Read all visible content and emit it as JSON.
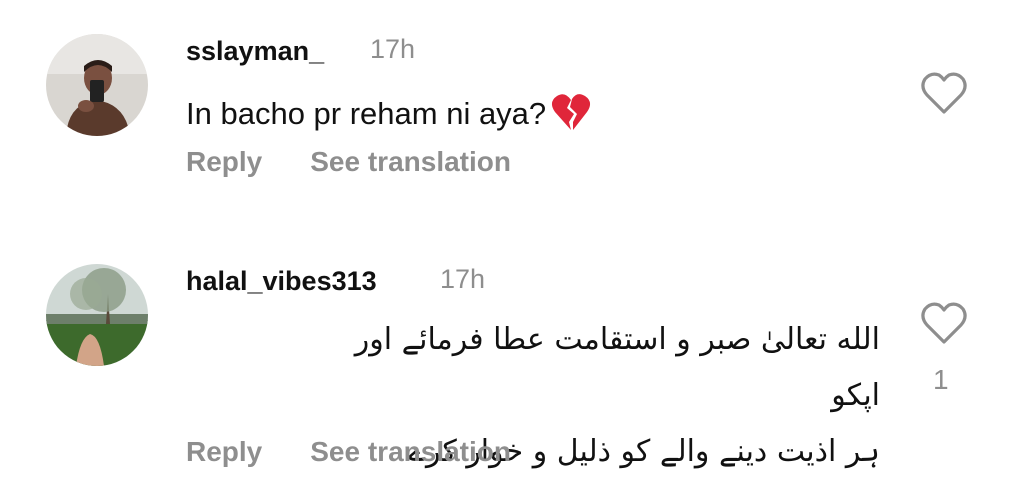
{
  "comments": [
    {
      "username": "sslayman_",
      "time": "17h",
      "text": "In bacho pr reham ni aya?",
      "emoji": "broken-heart",
      "reply_label": "Reply",
      "translate_label": "See translation",
      "likes": ""
    },
    {
      "username": "halal_vibes313",
      "time": "17h",
      "text_line1": "الله تعالیٰ صبر و استقامت عطا فرمائے اور اپکو",
      "text_line2": "ہر اذیت دینے والے کو ذلیل و خوار کرے",
      "reply_label": "Reply",
      "translate_label": "See translation",
      "likes": "1"
    }
  ],
  "colors": {
    "text": "#111111",
    "muted": "#8e8e8e",
    "emoji_red": "#e0263a"
  },
  "icons": [
    "heart-outline-icon",
    "broken-heart-emoji"
  ]
}
